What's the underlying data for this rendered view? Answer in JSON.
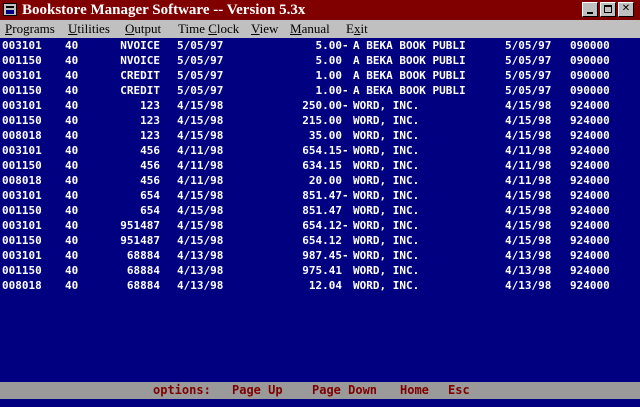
{
  "window": {
    "title": "Bookstore Manager Software -- Version 5.3x",
    "minimize_icon": "minimize-icon",
    "maximize_icon": "maximize-icon",
    "close_icon": "close-icon",
    "close_label": "✕"
  },
  "menu": [
    {
      "label": "Programs",
      "accel": "P",
      "rest": "rograms"
    },
    {
      "label": "Utilities",
      "accel": "U",
      "rest": "tilities"
    },
    {
      "label": "Output",
      "accel": "O",
      "rest": "utput"
    },
    {
      "label": "Time Clock",
      "pre": "Time ",
      "accel": "C",
      "rest": "lock"
    },
    {
      "label": "View",
      "accel": "V",
      "rest": "iew"
    },
    {
      "label": "Manual",
      "accel": "M",
      "rest": "anual"
    },
    {
      "label": "Exit",
      "pre": "E",
      "accel": "x",
      "rest": "it"
    }
  ],
  "rows": [
    {
      "acct": "003101",
      "code": "40",
      "ref": "NVOICE",
      "date": "5/05/97",
      "amount": "5.00",
      "sign": "-",
      "vendor": "A BEKA BOOK PUBLI",
      "date2": "5/05/97",
      "num": "090000"
    },
    {
      "acct": "001150",
      "code": "40",
      "ref": "NVOICE",
      "date": "5/05/97",
      "amount": "5.00",
      "sign": "",
      "vendor": "A BEKA BOOK PUBLI",
      "date2": "5/05/97",
      "num": "090000"
    },
    {
      "acct": "003101",
      "code": "40",
      "ref": "CREDIT",
      "date": "5/05/97",
      "amount": "1.00",
      "sign": "",
      "vendor": "A BEKA BOOK PUBLI",
      "date2": "5/05/97",
      "num": "090000"
    },
    {
      "acct": "001150",
      "code": "40",
      "ref": "CREDIT",
      "date": "5/05/97",
      "amount": "1.00",
      "sign": "-",
      "vendor": "A BEKA BOOK PUBLI",
      "date2": "5/05/97",
      "num": "090000"
    },
    {
      "acct": "003101",
      "code": "40",
      "ref": "123",
      "date": "4/15/98",
      "amount": "250.00",
      "sign": "-",
      "vendor": "WORD, INC.",
      "date2": "4/15/98",
      "num": "924000"
    },
    {
      "acct": "001150",
      "code": "40",
      "ref": "123",
      "date": "4/15/98",
      "amount": "215.00",
      "sign": "",
      "vendor": "WORD, INC.",
      "date2": "4/15/98",
      "num": "924000"
    },
    {
      "acct": "008018",
      "code": "40",
      "ref": "123",
      "date": "4/15/98",
      "amount": "35.00",
      "sign": "",
      "vendor": "WORD, INC.",
      "date2": "4/15/98",
      "num": "924000"
    },
    {
      "acct": "003101",
      "code": "40",
      "ref": "456",
      "date": "4/11/98",
      "amount": "654.15",
      "sign": "-",
      "vendor": "WORD, INC.",
      "date2": "4/11/98",
      "num": "924000"
    },
    {
      "acct": "001150",
      "code": "40",
      "ref": "456",
      "date": "4/11/98",
      "amount": "634.15",
      "sign": "",
      "vendor": "WORD, INC.",
      "date2": "4/11/98",
      "num": "924000"
    },
    {
      "acct": "008018",
      "code": "40",
      "ref": "456",
      "date": "4/11/98",
      "amount": "20.00",
      "sign": "",
      "vendor": "WORD, INC.",
      "date2": "4/11/98",
      "num": "924000"
    },
    {
      "acct": "003101",
      "code": "40",
      "ref": "654",
      "date": "4/15/98",
      "amount": "851.47",
      "sign": "-",
      "vendor": "WORD, INC.",
      "date2": "4/15/98",
      "num": "924000"
    },
    {
      "acct": "001150",
      "code": "40",
      "ref": "654",
      "date": "4/15/98",
      "amount": "851.47",
      "sign": "",
      "vendor": "WORD, INC.",
      "date2": "4/15/98",
      "num": "924000"
    },
    {
      "acct": "003101",
      "code": "40",
      "ref": "951487",
      "date": "4/15/98",
      "amount": "654.12",
      "sign": "-",
      "vendor": "WORD, INC.",
      "date2": "4/15/98",
      "num": "924000"
    },
    {
      "acct": "001150",
      "code": "40",
      "ref": "951487",
      "date": "4/15/98",
      "amount": "654.12",
      "sign": "",
      "vendor": "WORD, INC.",
      "date2": "4/15/98",
      "num": "924000"
    },
    {
      "acct": "003101",
      "code": "40",
      "ref": "68884",
      "date": "4/13/98",
      "amount": "987.45",
      "sign": "-",
      "vendor": "WORD, INC.",
      "date2": "4/13/98",
      "num": "924000"
    },
    {
      "acct": "001150",
      "code": "40",
      "ref": "68884",
      "date": "4/13/98",
      "amount": "975.41",
      "sign": "",
      "vendor": "WORD, INC.",
      "date2": "4/13/98",
      "num": "924000"
    },
    {
      "acct": "008018",
      "code": "40",
      "ref": "68884",
      "date": "4/13/98",
      "amount": "12.04",
      "sign": "",
      "vendor": "WORD, INC.",
      "date2": "4/13/98",
      "num": "924000"
    }
  ],
  "status": {
    "options_label": "options:",
    "page_up": "Page Up",
    "page_down": "Page Down",
    "home": "Home",
    "esc": "Esc"
  },
  "colors": {
    "title_bar": "#800000",
    "terminal_bg": "#000080",
    "terminal_text": "#ffffff",
    "status_bg": "#9a9a9a",
    "status_text": "#800000"
  }
}
